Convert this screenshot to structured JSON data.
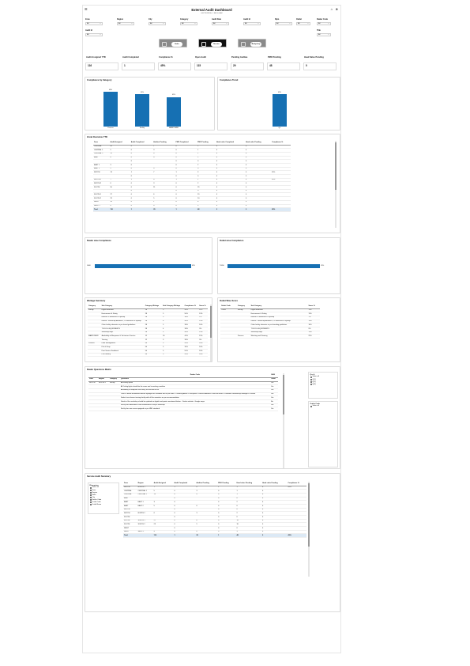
{
  "header": {
    "title": "External Audit Dashboard",
    "subtitle": "LAST REFRESH: 1 JAN 00:00AM",
    "menu_icon": "menu-icon",
    "home_icon": "home-icon",
    "clear_filter_icon": "clear-filter-icon"
  },
  "filters": [
    {
      "label": "Zone",
      "value": "All"
    },
    {
      "label": "Region",
      "value": "All"
    },
    {
      "label": "City",
      "value": "All"
    },
    {
      "label": "Category",
      "value": "All"
    },
    {
      "label": "Audit Date",
      "value": "All"
    },
    {
      "label": "Audit Id",
      "value": "All"
    },
    {
      "label": "Rpm",
      "value": "All"
    },
    {
      "label": "Outlet",
      "value": "All"
    },
    {
      "label": "Dealer Code",
      "value": "All"
    },
    {
      "label": "Audit Id",
      "value": "All"
    },
    {
      "label": "Title",
      "value": "All"
    }
  ],
  "tabs": [
    {
      "label": "Sales"
    },
    {
      "label": "Service"
    },
    {
      "label": "Bodyshop"
    }
  ],
  "kpis": [
    {
      "label": "Audit Assigned YTD",
      "value": "116"
    },
    {
      "label": "Audit Completed",
      "value": "1"
    },
    {
      "label": "Compliance %",
      "value": "45%"
    },
    {
      "label": "Open Audit",
      "value": "115"
    },
    {
      "label": "Pending Auditee",
      "value": "29"
    },
    {
      "label": "PMO Pending",
      "value": "48"
    },
    {
      "label": "Head Sales Pending",
      "value": "0"
    }
  ],
  "compliance_by_category": {
    "title": "Compliance by Category",
    "chart_data": {
      "type": "bar",
      "categories": [
        "Process",
        "Facility",
        "MANPOWER"
      ],
      "values": [
        48,
        45,
        41
      ],
      "labels": [
        "48%",
        "45%",
        "41%"
      ],
      "ylim": [
        0,
        55
      ]
    }
  },
  "compliance_trend": {
    "title": "Compliance Trend",
    "chart_data": {
      "type": "bar",
      "categories": [
        "Q1"
      ],
      "values": [
        45
      ],
      "labels": [
        "45%"
      ],
      "ylim": [
        0,
        55
      ]
    }
  },
  "zonal_overview": {
    "title": "Zonal Overview YTD",
    "columns": [
      "Zone",
      "Audit Assigned",
      "Audit Completed",
      "Auditee Pending",
      "PMO Completed",
      "PMO Pending",
      "Head sales Completed",
      "Head sales Pending",
      "Compliance %"
    ],
    "rows": [
      [
        "CENTRAL",
        "20",
        "0",
        "7",
        "0",
        "2",
        "0",
        "0",
        ""
      ],
      [
        "CENTRAL 1",
        "5",
        "0",
        "3",
        "0",
        "1",
        "0",
        "0",
        ""
      ],
      [
        "CENTRAL 2",
        "15",
        "0",
        "4",
        "0",
        "1",
        "0",
        "0",
        ""
      ],
      [
        "EAST",
        "8",
        "0",
        "0",
        "0",
        "2",
        "0",
        "0",
        ""
      ],
      [
        "",
        "",
        "0",
        "",
        "0",
        "0",
        "0",
        "0",
        ""
      ],
      [
        "EAST 1",
        "3",
        "0",
        "",
        "0",
        "2",
        "0",
        "0",
        ""
      ],
      [
        "EAST 2",
        "5",
        "0",
        "0",
        "0",
        "0",
        "0",
        "0",
        ""
      ],
      [
        "NORTH",
        "13",
        "1",
        "7",
        "1",
        "3",
        "0",
        "0",
        "45%"
      ],
      [
        "",
        "",
        "0",
        "",
        "0",
        "0",
        "0",
        "0",
        ""
      ],
      [
        "NORTH 1",
        "7",
        "1",
        "4",
        "1",
        "1",
        "0",
        "0",
        "45%"
      ],
      [
        "NORTH 2",
        "6",
        "0",
        "3",
        "0",
        "2",
        "0",
        "0",
        ""
      ],
      [
        "SOUTH",
        "50",
        "0",
        "11",
        "0",
        "29",
        "0",
        "0",
        ""
      ],
      [
        "",
        "",
        "0",
        "",
        "0",
        "0",
        "0",
        "0",
        ""
      ],
      [
        "SOUTH 1",
        "27",
        "0",
        "6",
        "0",
        "19",
        "0",
        "0",
        ""
      ],
      [
        "SOUTH 2",
        "23",
        "0",
        "5",
        "0",
        "10",
        "0",
        "0",
        ""
      ],
      [
        "WEST",
        "10",
        "0",
        "1",
        "0",
        "8",
        "0",
        "0",
        ""
      ],
      [
        "WEST 1",
        "4",
        "0",
        "0",
        "0",
        "3",
        "0",
        "0",
        ""
      ]
    ],
    "total": [
      "Total",
      "116",
      "1",
      "29",
      "1",
      "48",
      "0",
      "0",
      "45%"
    ]
  },
  "dealer_compliance": {
    "title": "Dealer wise Compliance",
    "chart_data": {
      "type": "bar",
      "categories": [
        "D400"
      ],
      "values": [
        45
      ],
      "labels": [
        "45%"
      ],
      "xlim": [
        0,
        48
      ]
    }
  },
  "outlet_compliance": {
    "title": "Outlet wise Compliance",
    "chart_data": {
      "type": "bar",
      "categories": [
        "T4050"
      ],
      "values": [
        45
      ],
      "labels": [
        "45%"
      ],
      "xlim": [
        0,
        48
      ]
    }
  },
  "weightage_summary": {
    "title": "Weitage Summary",
    "columns": [
      "Category",
      "Sub Category",
      "Category Weitage",
      "Sub Category Weitage",
      "Compliance %",
      "Score %"
    ],
    "rows": [
      [
        "Facility",
        "Digital Elements",
        "28",
        "5",
        "50%",
        "11%"
      ],
      [
        "",
        "Environment & Safety",
        "28",
        "5",
        "50%",
        "13%"
      ],
      [
        "",
        "Exterior ID adherence & upkeep",
        "28",
        "5",
        "39%",
        "7%"
      ],
      [
        "",
        "Interior / Workshop Ambience, CI adherence & upkeep",
        "28",
        "6",
        "50%",
        "13%"
      ],
      [
        "",
        "Other facility elements as per brand guidelines",
        "28",
        "5",
        "39%",
        "10%"
      ],
      [
        "",
        "TOOLS & EQUIPMENTS",
        "28",
        "4",
        "33%",
        "9%"
      ],
      [
        "",
        "Workshop Bays",
        "28",
        "3",
        "50%",
        "13%"
      ],
      [
        "MANPOWER",
        "Availability of Manpower & Technician Practice",
        "12",
        "16",
        "41%",
        "15%"
      ],
      [
        "",
        "Training",
        "12",
        "9",
        "39%",
        "9%"
      ],
      [
        "Process",
        "Floor Management",
        "50",
        "5",
        "55%",
        "10%"
      ],
      [
        "",
        "Pick & Drop",
        "50",
        "5",
        "35%",
        "10%"
      ],
      [
        "",
        "Post Service Feedback",
        "50",
        "5",
        "55%",
        "10%"
      ],
      [
        "",
        "Pre Delivery",
        "50",
        "5",
        "55%",
        "10%"
      ]
    ]
  },
  "outlet_wise_score": {
    "title": "Outlet Wise Score",
    "columns": [
      "Outlet Code",
      "Category",
      "Sub Category",
      "Score %"
    ],
    "rows": [
      [
        "T4050",
        "Facility",
        "Digital Elements",
        "11%"
      ],
      [
        "",
        "",
        "Environment & Safety",
        "13%"
      ],
      [
        "",
        "",
        "Exterior ID adherence & upkeep",
        "7%"
      ],
      [
        "",
        "",
        "Interior / Workshop Ambience, CI adherence & upkeep",
        "13%"
      ],
      [
        "",
        "",
        "Other facility elements as per branding guidelines",
        "10%"
      ],
      [
        "",
        "",
        "TOOLS & EQUIPMENTS",
        "9%"
      ],
      [
        "",
        "",
        "Workshop Bays",
        "13%"
      ],
      [
        "",
        "Process",
        "Washing and Cleaning",
        "25%"
      ]
    ]
  },
  "question_matrix": {
    "title": "Dealer Questions Matrix",
    "header_group": "Dealer Code",
    "group_value": "C400",
    "sub_header": "T4050",
    "columns": [
      "Zone",
      "Region",
      "Category",
      "Questions"
    ],
    "rows": [
      {
        "zone": "NORTH",
        "region": "NORTH 1",
        "category": "Facility",
        "q": "Accessory panel",
        "v": "Yes"
      },
      {
        "zone": "",
        "region": "",
        "category": "",
        "q": "All Ceiling lights should be the same and in working condition",
        "v": "Yes"
      },
      {
        "zone": "",
        "region": "",
        "category": "",
        "q": "Availability of adequate machinery and infrastructure",
        "v": "Yes"
      },
      {
        "zone": "",
        "region": "",
        "category": "",
        "q": "Check if below mentioned internal signages are available and in pre items: 1.Washing Areas 2.Reception 3.Service Advisors 4.Service Head 5.Customer Relationship Manager 6.Cashier",
        "v": "Yes"
      },
      {
        "zone": "",
        "region": "",
        "category": "",
        "q": "Dealer has inhouse training facility with all the amenities as per recommendation",
        "v": "Yes"
      },
      {
        "zone": "",
        "region": "",
        "category": "",
        "q": "Details of the workshop should be updated on digital touchpoints mentioned below: - Dealer website - Google maps",
        "v": "No"
      },
      {
        "zone": "",
        "region": "",
        "category": "",
        "q": "Facility has dedicated & well maintained EV bay in workshop",
        "v": "Yes"
      },
      {
        "zone": "",
        "region": "",
        "category": "",
        "q": "Facility has own room equipped as per HML standard",
        "v": "Yes"
      }
    ]
  },
  "qm_slicer": {
    "title": "Qu..ft",
    "items": [
      "Select all",
      "Q(1)",
      "Q(2)",
      "Q(3)"
    ]
  },
  "qm_slicer2": {
    "title": "Outlet Code",
    "items": [
      "Select all"
    ]
  },
  "service_summary": {
    "title": "Service Audit Summary",
    "slicer_title": "Dimension",
    "slicer_items": [
      "Select all",
      "Zone",
      "Region",
      "State",
      "City",
      "Dealer Code",
      "Outlet Code",
      "Outlet Name"
    ],
    "slicer_checked": [
      false,
      true,
      true,
      false,
      false,
      false,
      false,
      false
    ],
    "columns": [
      "Zone",
      "Region",
      "Audit Assigned",
      "Audit Completed",
      "Auditee Pending",
      "PMO Pending",
      "Head sales Pending",
      "Head sales Pending",
      "Compliance %"
    ],
    "rows": [
      [
        "NORTH",
        "NORTH 1",
        "7",
        "1",
        "4",
        "1",
        "1",
        "0",
        "45%"
      ],
      [
        "CENTRAL",
        "CENTRAL 1",
        "5",
        "0",
        "3",
        "0",
        "1",
        "0",
        ""
      ],
      [
        "CENTRAL",
        "CENTRAL 2",
        "15",
        "0",
        "4",
        "0",
        "1",
        "0",
        ""
      ],
      [
        "EAST",
        "",
        "",
        "0",
        "",
        "0",
        "0",
        "0",
        ""
      ],
      [
        "EAST",
        "EAST 1",
        "3",
        "0",
        "",
        "0",
        "2",
        "0",
        ""
      ],
      [
        "EAST",
        "EAST 2",
        "5",
        "0",
        "0",
        "0",
        "0",
        "0",
        ""
      ],
      [
        "NORTH",
        "",
        "",
        "0",
        "",
        "0",
        "0",
        "0",
        ""
      ],
      [
        "NORTH",
        "NORTH 2",
        "6",
        "0",
        "3",
        "0",
        "2",
        "0",
        ""
      ],
      [
        "SOUTH",
        "",
        "",
        "0",
        "",
        "0",
        "0",
        "0",
        ""
      ],
      [
        "SOUTH",
        "SOUTH 1",
        "27",
        "0",
        "6",
        "0",
        "19",
        "0",
        ""
      ],
      [
        "SOUTH",
        "SOUTH 2",
        "23",
        "0",
        "5",
        "0",
        "10",
        "0",
        ""
      ],
      [
        "WEST",
        "",
        "",
        "0",
        "",
        "0",
        "0",
        "0",
        ""
      ],
      [
        "WEST",
        "WEST 1",
        "4",
        "0",
        "0",
        "0",
        "3",
        "0",
        ""
      ]
    ],
    "total": [
      "Total",
      "",
      "116",
      "1",
      "29",
      "1",
      "48",
      "0",
      "45%"
    ]
  }
}
